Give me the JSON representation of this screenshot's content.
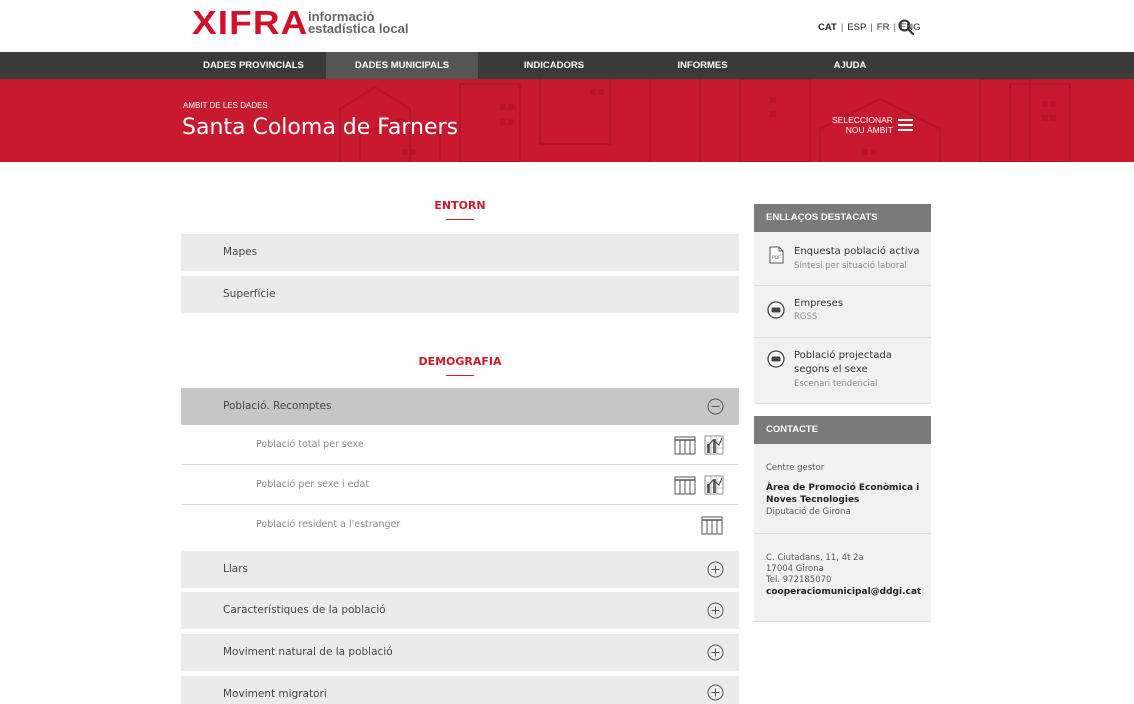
{
  "header": {
    "logo_main": "XIFRA",
    "logo_line1": "informació",
    "logo_line2": "estadística local",
    "languages": [
      "CAT",
      "ESP",
      "FR",
      "ENG"
    ]
  },
  "nav": {
    "items": [
      "DADES PROVINCIALS",
      "DADES MUNICIPALS",
      "INDICADORS",
      "INFORMES",
      "AJUDA"
    ],
    "active": "DADES MUNICIPALS"
  },
  "banner": {
    "subtitle": "AMBIT DE LES DADES",
    "title": "Santa Coloma de Farners",
    "select_line1": "SELECCIONAR",
    "select_line2": "NOU ÀMBIT"
  },
  "sections": {
    "entorn": {
      "title": "ENTORN",
      "rows": [
        "Mapes",
        "Superfície"
      ]
    },
    "demografia": {
      "title": "DEMOGRAFIA",
      "open_row": "Població. Recomptes",
      "subrows": [
        "Població total per sexe",
        "Població per sexe i edat",
        "Població resident a l'estranger"
      ],
      "rows": [
        "Llars",
        "Característiques de la població",
        "Moviment natural de la població",
        "Moviment migratori"
      ]
    }
  },
  "sidebar": {
    "links_title": "ENLLAÇOS DESTACATS",
    "links": [
      {
        "title": "Enquesta població activa",
        "sub": "Síntesi per situació laboral",
        "icon": "pdf-icon"
      },
      {
        "title": "Empreses",
        "sub": "RGSS",
        "icon": "database-icon"
      },
      {
        "title_line1": "Població projectada",
        "title_line2": "segons el sexe",
        "sub": "Escenari tendencial",
        "icon": "database-icon"
      }
    ],
    "contact_title": "CONTACTE",
    "contact": {
      "label": "Centre gestor",
      "org_line1": "Àrea de Promoció Econòmica i",
      "org_line2": "Noves Tecnologies",
      "org_sub": "Diputació de Girona",
      "address": "C. Ciutadans, 11, 4t 2a",
      "city": "17004 Girona",
      "phone": "Tel. 972185070",
      "email": "cooperaciomunicipal@ddgi.cat"
    }
  },
  "colors": {
    "brand_red": "#c81a2e",
    "nav_dark": "#3a3a3a",
    "sidebar_head": "#7a7a7a"
  }
}
